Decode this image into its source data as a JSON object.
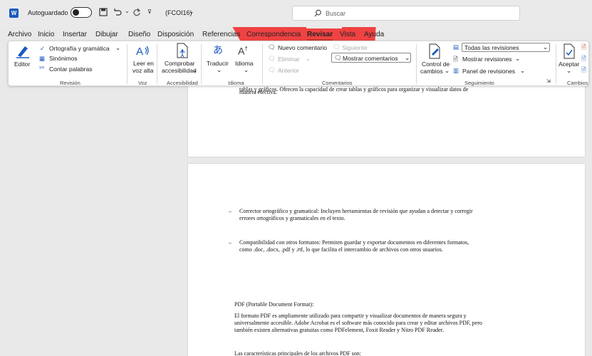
{
  "titlebar": {
    "autosave_label": "Autoguardado",
    "document_name": "(FCOI16)",
    "search_placeholder": "Buscar"
  },
  "menu": {
    "tabs": [
      "Archivo",
      "Inicio",
      "Insertar",
      "Dibujar",
      "Diseño",
      "Disposición",
      "Referencias",
      "Correspondencia",
      "Revisar",
      "Vista",
      "Ayuda"
    ],
    "active_tab": "Revisar"
  },
  "ribbon": {
    "editor": "Editor",
    "spelling": "Ortografía y gramática",
    "synonyms": "Sinónimos",
    "word_count": "Contar palabras",
    "group_revision": "Revisión",
    "read_aloud_1": "Leer en",
    "read_aloud_2": "voz alta",
    "group_voice": "Voz",
    "check_accessibility_1": "Comprobar",
    "check_accessibility_2": "accesibilidad",
    "group_accessibility": "Accesibilidad",
    "translate": "Traducir",
    "language": "Idioma",
    "group_language": "Idioma",
    "new_comment": "Nuevo comentario",
    "next": "Siguiente",
    "delete": "Eliminar",
    "previous": "Anterior",
    "show_comments": "Mostrar comentarios",
    "group_comments": "Comentarios",
    "track_changes_1": "Control de",
    "track_changes_2": "cambios",
    "all_markup": "Todas las revisiones",
    "show_markup": "Mostrar revisiones",
    "reviewing_pane": "Panel de revisiones",
    "group_tracking": "Seguimiento",
    "accept": "Aceptar",
    "group_changes": "Cambios"
  },
  "document": {
    "page1_partial_line": "tablas y gráficos. Ofrecen la capacidad de crear tablas y gráficos para organizar y visualizar datos de",
    "page1_last_line": "manera efectiva.",
    "bullet_dash": "–",
    "bullet1_line1": "Corrector ortográfico y gramatical: Incluyen herramientas de revisión que ayudan a detectar y corregir",
    "bullet1_line2": "errores ortográficos y gramaticales en el texto.",
    "bullet2_line1": "Compatibilidad con otros formatos: Permiten guardar y exportar documentos en diferentes formatos,",
    "bullet2_line2": "como .doc, .docx, .pdf y .rtf, lo que facilita el intercambio de archivos con otros usuarios.",
    "pdf_heading": "PDF (Portable Document Format):",
    "pdf_line1": "El formato PDF es ampliamente utilizado para compartir y visualizar documentos de manera segura y",
    "pdf_line2": "universalmente accesible. Adobe Acrobat es el software más conocido para crear y editar archivos PDF, pero",
    "pdf_line3": "también existen alternativas gratuitas como PDFelement, Foxit Reader y Nitro PDF Reader.",
    "pdf_features": "Las características principales de los archivos PDF son:"
  },
  "colors": {
    "accent": "#c0392b",
    "word_blue": "#185abd",
    "watermark": "#ef4242"
  }
}
